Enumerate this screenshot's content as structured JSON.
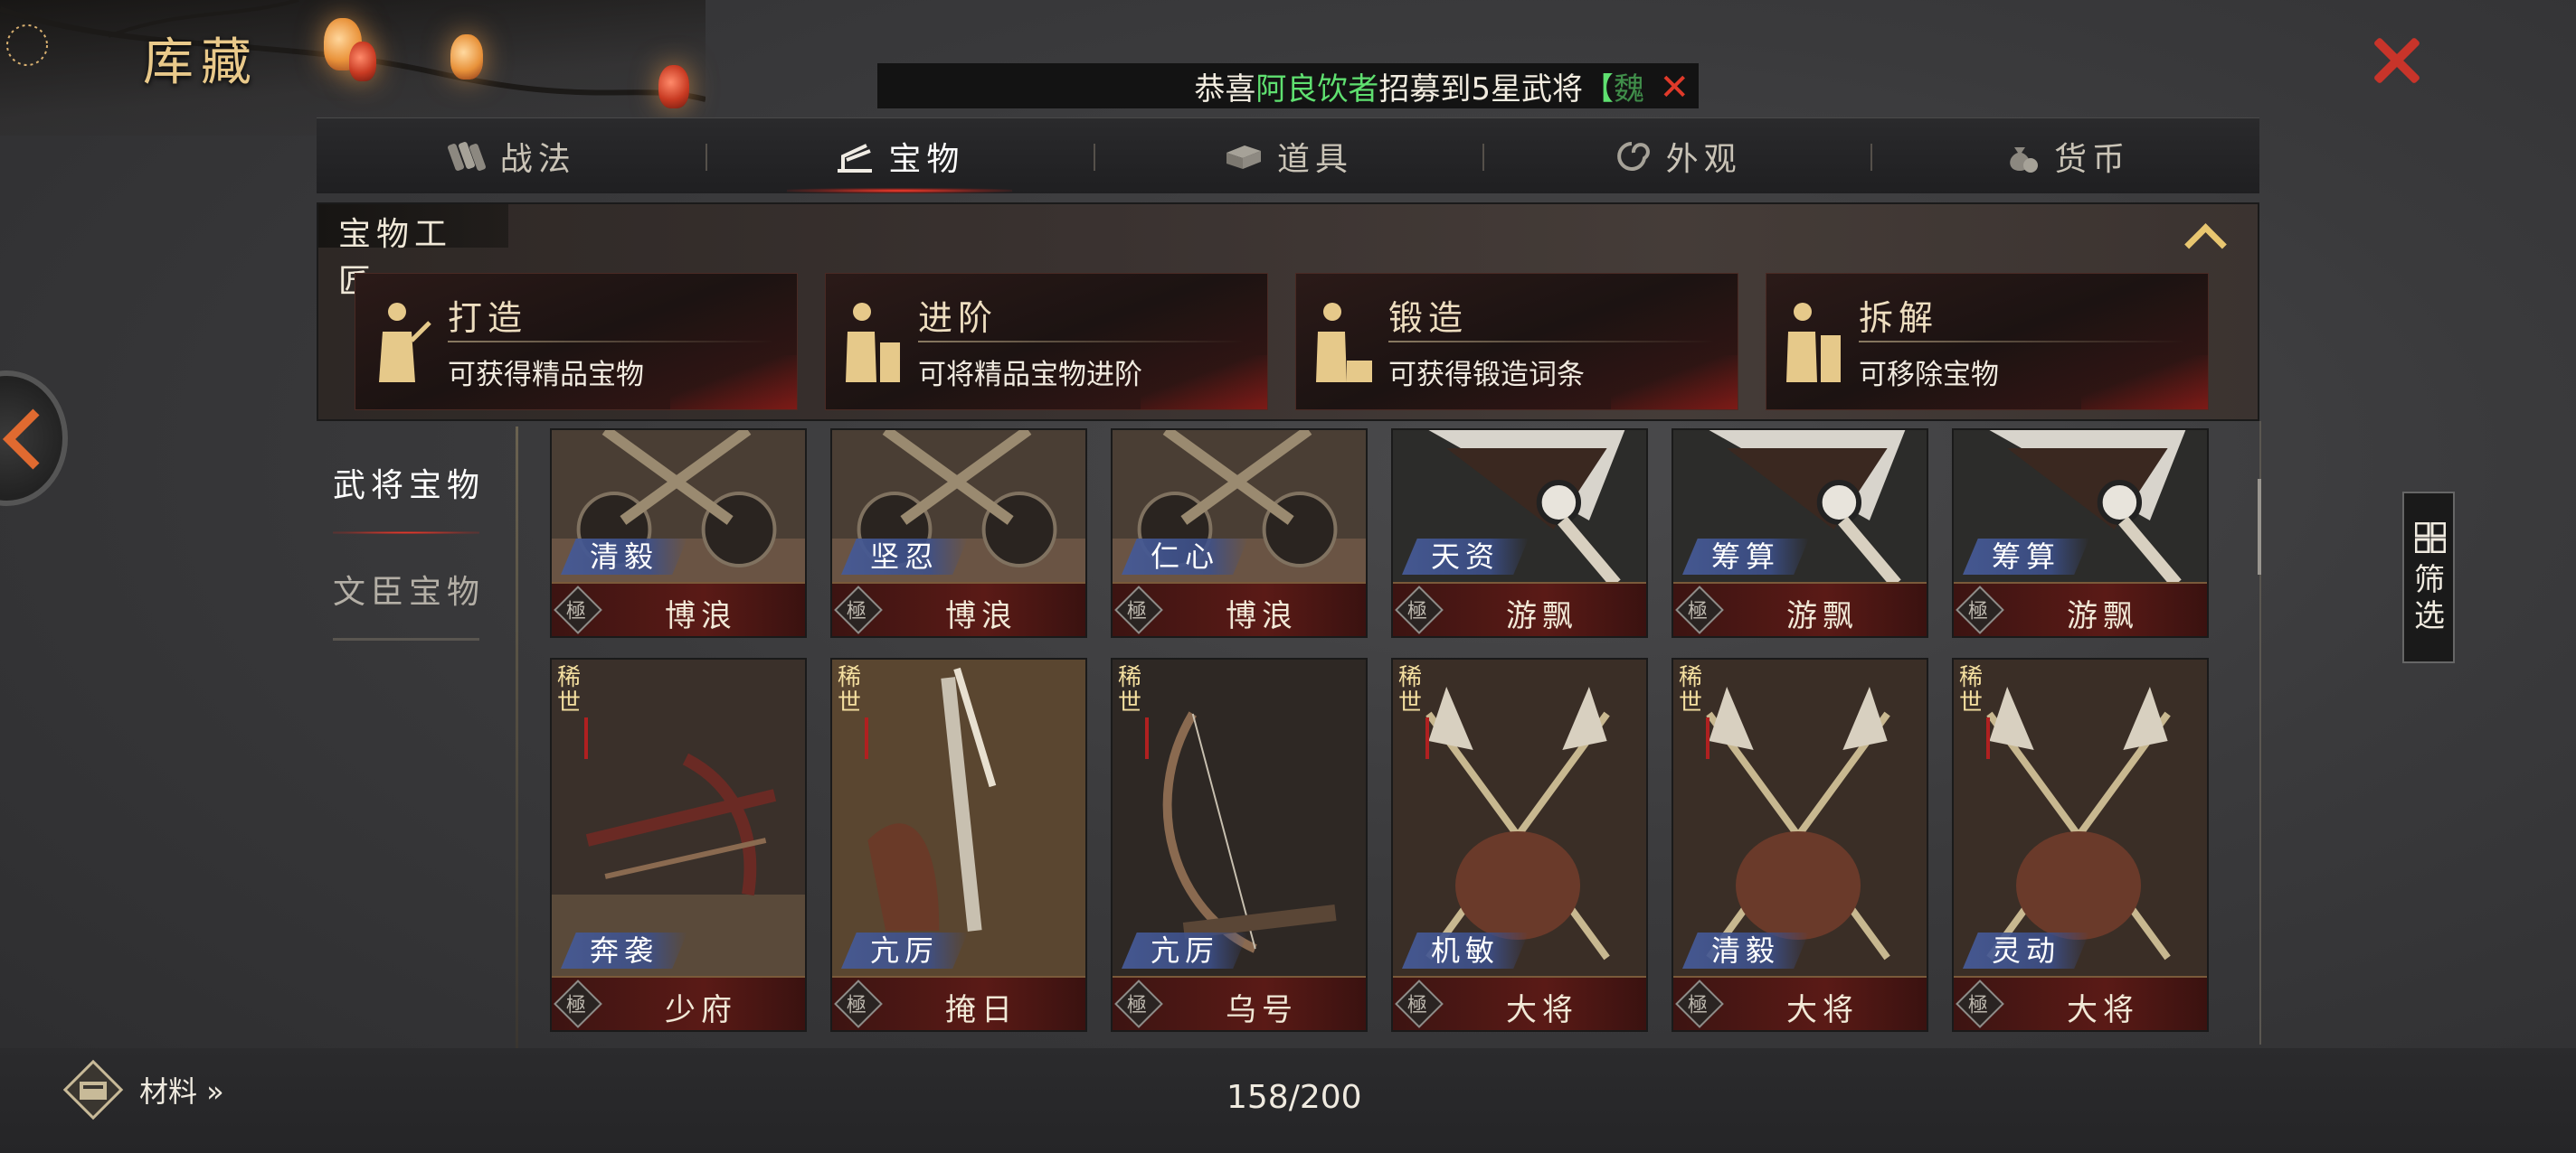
{
  "window": {
    "title": "库藏"
  },
  "broadcast": {
    "prefix": "恭喜",
    "player": "阿良饮者",
    "middle": "招募到5星武将",
    "suffix": "【",
    "tail": "魏"
  },
  "tabs": [
    {
      "label": "战法",
      "icon": "scroll-bundle-icon"
    },
    {
      "label": "宝物",
      "icon": "treasure-stand-icon",
      "active": true
    },
    {
      "label": "道具",
      "icon": "item-box-icon"
    },
    {
      "label": "外观",
      "icon": "swirl-icon"
    },
    {
      "label": "货币",
      "icon": "money-bag-icon"
    }
  ],
  "artisan": {
    "title": "宝物工匠",
    "cards": [
      {
        "name": "打造",
        "desc": "可获得精品宝物"
      },
      {
        "name": "进阶",
        "desc": "可将精品宝物进阶"
      },
      {
        "name": "锻造",
        "desc": "可获得锻造词条"
      },
      {
        "name": "拆解",
        "desc": "可移除宝物"
      }
    ]
  },
  "categories": [
    {
      "label": "武将宝物",
      "active": true
    },
    {
      "label": "文臣宝物",
      "active": false
    }
  ],
  "items": [
    {
      "trait": "清毅",
      "name": "博浪",
      "grade": "極",
      "art": "mace"
    },
    {
      "trait": "坚忍",
      "name": "博浪",
      "grade": "極",
      "art": "mace"
    },
    {
      "trait": "仁心",
      "name": "博浪",
      "grade": "極",
      "art": "mace"
    },
    {
      "trait": "天资",
      "name": "游飘",
      "grade": "極",
      "art": "fan"
    },
    {
      "trait": "筹算",
      "name": "游飘",
      "grade": "極",
      "art": "fan"
    },
    {
      "trait": "筹算",
      "name": "游飘",
      "grade": "極",
      "art": "fan"
    },
    {
      "trait": "奔袭",
      "name": "少府",
      "grade": "極",
      "rare": "稀世",
      "art": "crossbow"
    },
    {
      "trait": "亢厉",
      "name": "掩日",
      "grade": "極",
      "rare": "稀世",
      "art": "blade"
    },
    {
      "trait": "亢厉",
      "name": "乌号",
      "grade": "極",
      "rare": "稀世",
      "art": "bow"
    },
    {
      "trait": "机敏",
      "name": "大将",
      "grade": "極",
      "rare": "稀世",
      "art": "halberd"
    },
    {
      "trait": "清毅",
      "name": "大将",
      "grade": "極",
      "rare": "稀世",
      "art": "halberd"
    },
    {
      "trait": "灵动",
      "name": "大将",
      "grade": "極",
      "rare": "稀世",
      "art": "halberd"
    }
  ],
  "filter": {
    "label": "筛选"
  },
  "footer": {
    "materials_label": "材料 »",
    "count": "158/200"
  },
  "colors": {
    "accent_gold": "#e9c98a",
    "close_red": "#c8342a",
    "trait_blue": "#46609a",
    "highlight_green": "#5fe070"
  }
}
